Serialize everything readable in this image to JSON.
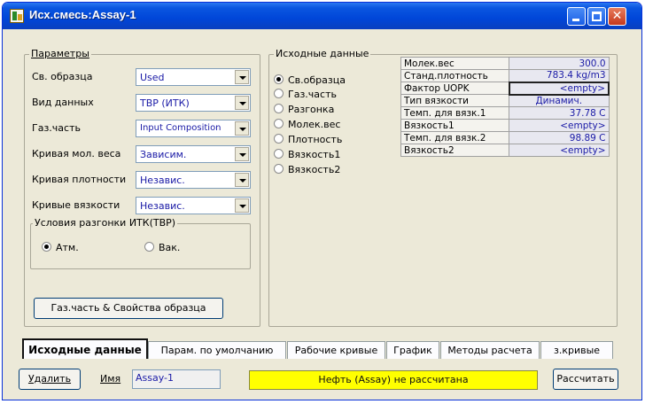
{
  "window": {
    "title": "Исх.смесь:Assay-1"
  },
  "params": {
    "group_title": "Параметры",
    "rows": [
      {
        "label": "Св. образца",
        "value": "Used"
      },
      {
        "label": "Вид данных",
        "value": "TBP (ИТК)"
      },
      {
        "label": "Газ.часть",
        "value": "Input Composition"
      },
      {
        "label": "Кривая мол. веса",
        "value": "Зависим."
      },
      {
        "label": "Кривая плотности",
        "value": "Независ."
      },
      {
        "label": "Кривые вязкости",
        "value": "Независ."
      }
    ],
    "conditions": {
      "title": "Условия разгонки ИТК(ТВР)",
      "options": [
        "Атм.",
        "Вак."
      ],
      "selected": "Атм."
    },
    "button": "Газ.часть & Свойства образца"
  },
  "input_data": {
    "group_title": "Исходные данные",
    "radios": [
      "Св.образца",
      "Газ.часть",
      "Разгонка",
      "Молек.вес",
      "Плотность",
      "Вязкость1",
      "Вязкость2"
    ],
    "selected": "Св.образца",
    "table": [
      {
        "key": "Молек.вес",
        "value": "300.0"
      },
      {
        "key": "Станд.плотность",
        "value": "783.4 kg/m3"
      },
      {
        "key": "Фактор UOPK",
        "value": "<empty>"
      },
      {
        "key": "Тип вязкости",
        "value": "Динамич."
      },
      {
        "key": "Темп. для вязк.1",
        "value": "37.78 C"
      },
      {
        "key": "Вязкость1",
        "value": "<empty>"
      },
      {
        "key": "Темп. для вязк.2",
        "value": "98.89 C"
      },
      {
        "key": "Вязкость2",
        "value": "<empty>"
      }
    ]
  },
  "tabs": [
    "Исходные данные",
    "Парам. по умолчанию",
    "Рабочие кривые",
    "График",
    "Методы расчета",
    "з.кривые"
  ],
  "bottom": {
    "delete_button": "Удалить",
    "name_label": "Имя",
    "name_value": "Assay-1",
    "status": "Нефть (Assay) не рассчитана",
    "calc_button": "Рассчитать"
  }
}
